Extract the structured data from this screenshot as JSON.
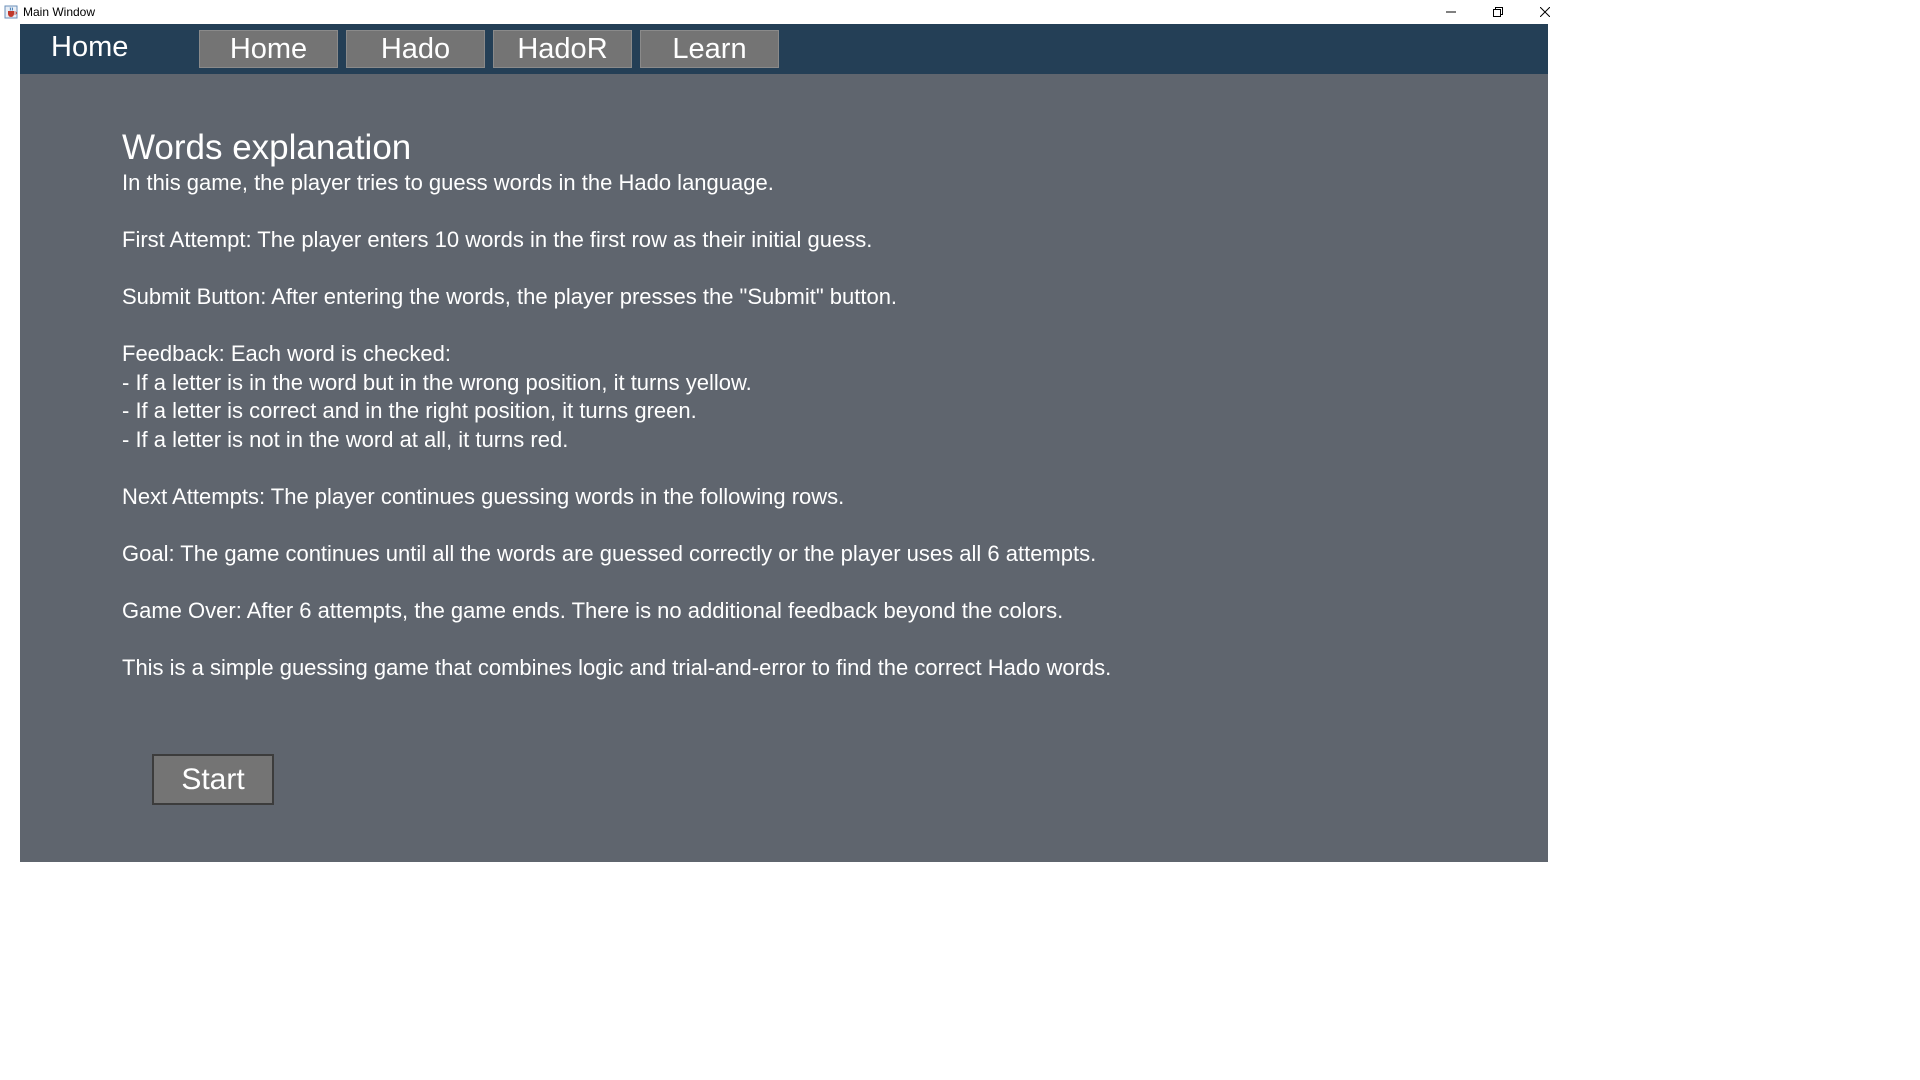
{
  "window": {
    "title": "Main Window",
    "icons": {
      "app": "java-cup-icon",
      "minimize": "minimize-icon",
      "restore": "restore-icon",
      "close": "close-icon"
    }
  },
  "nav": {
    "brand": "Home",
    "buttons": [
      "Home",
      "Hado",
      "HadoR",
      "Learn"
    ]
  },
  "content": {
    "heading": "Words explanation",
    "intro": "In this game, the player tries to guess words in the Hado language.",
    "first_attempt": "First Attempt: The player enters 10 words in the first row as their initial guess.",
    "submit_button": "Submit Button: After entering the words, the player presses the \"Submit\" button.",
    "feedback": [
      "Feedback: Each word is checked:",
      "- If a letter is in the word but in the wrong position, it turns yellow.",
      "- If a letter is correct and in the right position, it turns green.",
      "- If a letter is not in the word at all, it turns red."
    ],
    "next_attempts": "Next Attempts: The player continues guessing words in the following rows.",
    "goal": "Goal: The game continues until all the words are guessed correctly or the player uses all 6 attempts.",
    "game_over": "Game Over: After 6 attempts, the game ends. There is no additional feedback beyond the colors.",
    "summary": "This is a simple guessing game that combines logic and trial-and-error to find the correct Hado words."
  },
  "start_label": "Start",
  "colors": {
    "navbar": "#243f56",
    "panel": "#5f656e",
    "button": "#747474",
    "text": "#ffffff"
  }
}
